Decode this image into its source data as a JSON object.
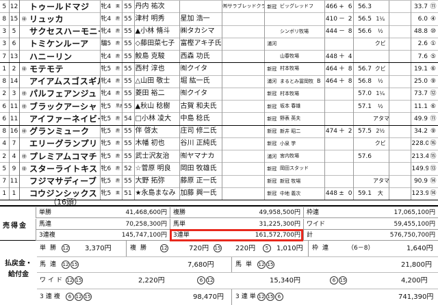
{
  "horses": [
    {
      "waku": "5",
      "umaban": "12",
      "mark": "",
      "name": "トゥールドマジ",
      "sex": "牝4",
      "sex_sub": "栗",
      "weight": "55",
      "jockey": "丹内 祐次",
      "trainer": "",
      "owner": "㈲サラブレッドクラブ・ライフアン",
      "breeder": "鈴木慎太郎",
      "region": "新冠",
      "farm": "ビッグレッドファーム",
      "bk": "",
      "bw": "466",
      "sign": "+",
      "chg": "6",
      "time": "56.3",
      "margin": "",
      "note": "",
      "pop": "",
      "odds": "33.7",
      "popw": "⑪"
    },
    {
      "waku": "8",
      "umaban": "15",
      "mark": "㊥",
      "name": "リュッカ",
      "sex": "牝4",
      "sex_sub": "鹿",
      "weight": "55",
      "jockey": "津村 明秀",
      "trainer": "星加 浩一",
      "owner": "",
      "breeder": "谷口牧場",
      "region": "",
      "farm": "",
      "bk": "",
      "bw": "410",
      "sign": "－",
      "chg": "2",
      "time": "56.5",
      "margin": "1¼",
      "note": "",
      "pop": "",
      "odds": "6.0",
      "popw": "④"
    },
    {
      "waku": "3",
      "umaban": "5",
      "mark": "",
      "name": "サクセスハーモニー",
      "sex": "牝4",
      "sex_sub": "鹿",
      "weight": "55",
      "jockey": "▲小林 脩斗",
      "trainer": "㈱タカシマ",
      "owner": "",
      "breeder": "久保田貴士",
      "region": "",
      "farm": "シンボリ牧場",
      "bk": "",
      "bw": "444",
      "sign": "－",
      "chg": "8",
      "time": "56.6",
      "margin": "½",
      "note": "",
      "pop": "",
      "odds": "48.8",
      "popw": "⑩"
    },
    {
      "waku": "3",
      "umaban": "6",
      "mark": "",
      "name": "トミケンルーア",
      "sex": "騸5",
      "sex_sub": "鹿",
      "weight": "55",
      "jockey": "◇藤田菜七子",
      "trainer": "富樫アキ子氏",
      "owner": "",
      "breeder": "竹内 正洋",
      "region": "浦河",
      "farm": "",
      "bk": "",
      "bw": "",
      "sign": "",
      "chg": "",
      "time": "",
      "margin": "クビ",
      "note": "",
      "pop": "",
      "odds": "2.6",
      "popw": "①"
    },
    {
      "waku": "7",
      "umaban": "13",
      "mark": "",
      "name": "ハニーリン",
      "sex": "牝4",
      "sex_sub": "鹿",
      "weight": "55",
      "jockey": "鮫島 克駿",
      "trainer": "西森 功氏",
      "owner": "",
      "breeder": "",
      "region": "",
      "farm": "山春牧場",
      "bk": "",
      "bw": "448",
      "sign": "＋",
      "chg": "4",
      "time": "",
      "margin": "",
      "note": "",
      "pop": "",
      "odds": "7.6",
      "popw": "⑤"
    },
    {
      "waku": "1",
      "umaban": "2",
      "mark": "㊥",
      "name": "モテモテ",
      "sex": "牝5",
      "sex_sub": "鹿",
      "weight": "55",
      "jockey": "西村 淳也",
      "trainer": "㈲クイタ",
      "owner": "",
      "breeder": "南井 克巳",
      "region": "新冠",
      "farm": "村本牧場",
      "bk": "",
      "bw": "464",
      "sign": "＋",
      "chg": "8",
      "time": "56.7",
      "margin": "クビ",
      "note": "",
      "pop": "",
      "odds": "19.1",
      "popw": "⑥"
    },
    {
      "waku": "8",
      "umaban": "14",
      "mark": "",
      "name": "アイアムスゴスギル",
      "sex": "牝4",
      "sex_sub": "鹿",
      "weight": "55",
      "jockey": "△山田 敬士",
      "trainer": "堀 紘一氏",
      "owner": "",
      "breeder": "奥平 雅士",
      "region": "浦河",
      "farm": "まるとみ冨岡牧場",
      "bk": "B",
      "bw": "464",
      "sign": "＋",
      "chg": "8",
      "time": "56.8",
      "margin": "½",
      "note": "",
      "pop": "",
      "odds": "25.0",
      "popw": "⑨"
    },
    {
      "waku": "2",
      "umaban": "3",
      "mark": "㊥",
      "name": "パルフェアンジュ",
      "sex": "牝4",
      "sex_sub": "鹿",
      "weight": "55",
      "jockey": "菱田 裕二",
      "trainer": "㈲クイタ",
      "owner": "",
      "breeder": "飯田 雄三",
      "region": "新冠",
      "farm": "村本牧場",
      "bk": "",
      "bw": "",
      "sign": "",
      "chg": "",
      "time": "57.0",
      "margin": "1¼",
      "note": "",
      "pop": "",
      "odds": "73.7",
      "popw": "⑫"
    },
    {
      "waku": "6",
      "umaban": "11",
      "mark": "㊥",
      "name": "ブラックアーシャ",
      "sex": "牝5",
      "sex_sub": "黒鹿",
      "weight": "55",
      "jockey": "▲秋山 稔樹",
      "trainer": "古賀 和夫氏",
      "owner": "",
      "breeder": "和田正一郎",
      "region": "新冠",
      "farm": "坂本 春雄",
      "bk": "",
      "bw": "",
      "sign": "",
      "chg": "",
      "time": "57.1",
      "margin": "½",
      "note": "",
      "pop": "",
      "odds": "11.1",
      "popw": "⑥"
    },
    {
      "waku": "6",
      "umaban": "11",
      "mark": "",
      "name": "アイファーネイビー",
      "sex": "牝5",
      "sex_sub": "鹿",
      "weight": "54",
      "jockey": "□小林 凌大",
      "trainer": "中島 稔氏",
      "owner": "",
      "breeder": "小島 茂之",
      "region": "新冠",
      "farm": "野表 英夫",
      "bk": "",
      "bw": "",
      "sign": "",
      "chg": "",
      "time": "",
      "margin": "アタマ",
      "note": "",
      "pop": "",
      "odds": "49.9",
      "popw": "⑪"
    },
    {
      "waku": "8",
      "umaban": "16",
      "mark": "㊥",
      "name": "グランミューク",
      "sex": "牝5",
      "sex_sub": "鹿",
      "weight": "55",
      "jockey": "伴 啓太",
      "trainer": "庄司 修二氏",
      "owner": "",
      "breeder": "根本 康広",
      "region": "新冠",
      "farm": "新井 昭二",
      "bk": "",
      "bw": "474",
      "sign": "＋",
      "chg": "2",
      "time": "57.5",
      "margin": "2½",
      "note": "",
      "pop": "",
      "odds": "34.2",
      "popw": "⑨"
    },
    {
      "waku": "4",
      "umaban": "7",
      "mark": "",
      "name": "エリーグランプリ",
      "sex": "牝5",
      "sex_sub": "鹿",
      "weight": "55",
      "jockey": "木幡 初也",
      "trainer": "谷川 正純氏",
      "owner": "",
      "breeder": "武市 康男",
      "region": "新冠",
      "farm": "小泉 学",
      "bk": "",
      "bw": "",
      "sign": "",
      "chg": "",
      "time": "",
      "margin": "クビ",
      "note": "",
      "pop": "",
      "odds": "228.0",
      "popw": "⑯"
    },
    {
      "waku": "2",
      "umaban": "4",
      "mark": "㊥",
      "name": "プレミアムコマチ",
      "sex": "牝5",
      "sex_sub": "鹿",
      "weight": "55",
      "jockey": "武士沢友治",
      "trainer": "㈲ヤマナカ",
      "owner": "",
      "breeder": "天間 昭一",
      "region": "浦河",
      "farm": "宮内牧場",
      "bk": "",
      "bw": "",
      "sign": "",
      "chg": "",
      "time": "57.6",
      "margin": "",
      "note": "",
      "pop": "",
      "odds": "213.4",
      "popw": "⑮"
    },
    {
      "waku": "5",
      "umaban": "9",
      "mark": "㊥",
      "name": "スターライトキス",
      "sex": "牝6",
      "sex_sub": "鹿",
      "weight": "52",
      "jockey": "☆菅原 明良",
      "trainer": "岡田 牧雄氏",
      "owner": "",
      "breeder": "新開 幸一",
      "region": "新冠",
      "farm": "岡田スタッド",
      "bk": "",
      "bw": "",
      "sign": "",
      "chg": "",
      "time": "",
      "margin": "",
      "note": "",
      "pop": "",
      "odds": "149.9",
      "popw": "⑬"
    },
    {
      "waku": "7",
      "umaban": "11",
      "mark": "",
      "name": "フジマサディーブ",
      "sex": "牝5",
      "sex_sub": "鹿",
      "weight": "55",
      "jockey": "大野 拓弥",
      "trainer": "藤原 正一氏",
      "owner": "",
      "breeder": "菊川 正達",
      "region": "新冠",
      "farm": "新冠 牧場",
      "bk": "",
      "bw": "",
      "sign": "",
      "chg": "",
      "time": "",
      "margin": "アタマ",
      "note": "",
      "pop": "",
      "odds": "90.9",
      "popw": "⑭"
    },
    {
      "waku": "1",
      "umaban": "1",
      "mark": "",
      "name": "コウジンシックス",
      "sex": "牝5",
      "sex_sub": "栗",
      "weight": "51",
      "jockey": "★永島まなみ",
      "trainer": "加藤 興一氏",
      "owner": "",
      "breeder": "和田 雄二",
      "region": "新冠",
      "farm": "中地 義次",
      "bk": "",
      "bw": "448",
      "sign": "±",
      "chg": "0",
      "time": "59.1",
      "margin": "大",
      "note": "",
      "pop": "",
      "odds": "123.9",
      "popw": "⑭"
    }
  ],
  "field_count": "（16頭）",
  "sales": {
    "label": "売得金",
    "rows": [
      [
        {
          "k": "単勝",
          "v": "41,468,600円"
        },
        {
          "k": "複勝",
          "v": "49,958,500円"
        },
        {
          "k": "枠連",
          "v": "17,065,100円"
        }
      ],
      [
        {
          "k": "馬連",
          "v": "70,258,300円"
        },
        {
          "k": "馬単",
          "v": "31,225,300円"
        },
        {
          "k": "ワイド",
          "v": "59,455,100円"
        }
      ],
      [
        {
          "k": "3連複",
          "v": "145,747,100円"
        },
        {
          "k": "3連単",
          "v": "161,572,700円"
        },
        {
          "k": "計",
          "v": "576,750,700円"
        }
      ]
    ]
  },
  "payouts": {
    "label_line1": "払戻金・",
    "label_line2": "給付金",
    "win": {
      "key": "単勝",
      "horse": "12",
      "amount": "3,370円"
    },
    "place": {
      "key": "複勝",
      "entries": [
        {
          "horse": "12",
          "amount": "720円"
        },
        {
          "horse": "15",
          "amount": "220円"
        },
        {
          "horse": "5",
          "amount": "1,010円"
        }
      ]
    },
    "bracket": {
      "key": "枠連",
      "combo": "（6－8）",
      "amount": "1,640円"
    },
    "quinella": {
      "key": "馬連",
      "combo": [
        "12",
        "15"
      ],
      "amount": "7,680円"
    },
    "exacta": {
      "key": "馬単",
      "combo": [
        "12",
        "15"
      ],
      "amount": "21,800円"
    },
    "wide": {
      "key": "ワイド",
      "entries": [
        {
          "combo": [
            "12",
            "15"
          ],
          "amount": "2,220円"
        },
        {
          "combo": [
            "6",
            "12"
          ],
          "amount": "15,340円"
        },
        {
          "combo": [
            "6",
            "15"
          ],
          "amount": "4,200円"
        }
      ]
    },
    "trio": {
      "key": "3連複",
      "combo": [
        "6",
        "12",
        "15"
      ],
      "amount": "98,470円"
    },
    "trifecta": {
      "key": "3連単",
      "combo": [
        "12",
        "15",
        "6"
      ],
      "amount": "741,390円"
    }
  },
  "colors": {
    "highlight": "#e8291d"
  }
}
